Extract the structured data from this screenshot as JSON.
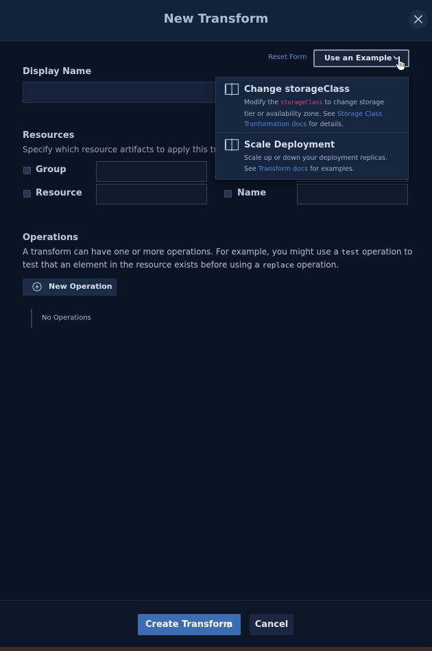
{
  "modal": {
    "title": "New Transform",
    "close_icon": "close-icon"
  },
  "top_actions": {
    "reset_label": "Reset Form",
    "example_label": "Use an Example"
  },
  "display_name": {
    "label": "Display Name",
    "value": ""
  },
  "resources": {
    "label": "Resources",
    "description": "Specify which resource artifacts to apply this transfo",
    "fields": {
      "group": "Group",
      "resource": "Resource",
      "name": "Name"
    }
  },
  "operations": {
    "label": "Operations",
    "desc_part1": "A transform can have one or more operations. For example, you might use a ",
    "desc_code1": "test",
    "desc_part2": " operation to test that an element in the resource exists before using a ",
    "desc_code2": "replace",
    "desc_part3": " operation.",
    "new_button": "New Operation",
    "empty_text": "No Operations"
  },
  "examples_menu": {
    "items": [
      {
        "title": "Change storageClass",
        "desc_a": "Modify the ",
        "desc_code": "storageClass",
        "desc_b": " to change storage tier or availability zone. See ",
        "desc_link": "Storage Class Tranformation docs",
        "desc_c": " for details."
      },
      {
        "title": "Scale Deployment",
        "desc_a": "Scale up or down your deployment replicas. See ",
        "desc_link": "Transform docs",
        "desc_c": " for examples."
      }
    ]
  },
  "footer": {
    "create_label": "Create Transform",
    "cancel_label": "Cancel"
  },
  "colors": {
    "accent": "#3c6cb4",
    "link": "#5b8fe0",
    "code_highlight": "#e0487f",
    "background": "#0b1424"
  }
}
